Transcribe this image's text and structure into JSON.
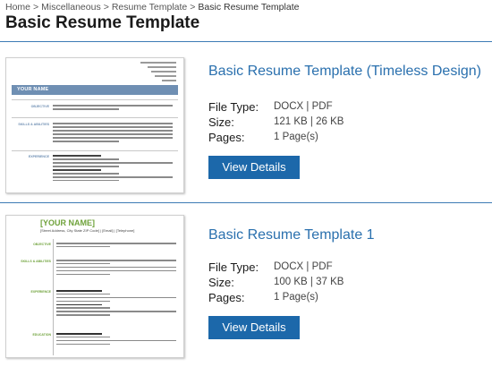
{
  "breadcrumb": {
    "items": [
      "Home",
      "Miscellaneous",
      "Resume Template"
    ],
    "separator": ">",
    "current": "Basic Resume Template"
  },
  "page": {
    "title": "Basic Resume Template"
  },
  "colors": {
    "accent": "#2a70ae",
    "button": "#1c68aa",
    "divider": "#3d7bb5",
    "thumb2_green": "#6fa23b",
    "thumb1_bar": "#6f8fb3"
  },
  "labels": {
    "file_type": "File Type:",
    "size": "Size:",
    "pages": "Pages:"
  },
  "templates": [
    {
      "title": "Basic Resume Template (Timeless Design)",
      "file_type": "DOCX | PDF",
      "size": "121 KB | 26 KB",
      "pages": "1 Page(s)",
      "button": "View Details",
      "thumbnail": {
        "name": "YOUR NAME",
        "sections": [
          "OBJECTIVE",
          "SKILLS & ABILITIES",
          "EXPERIENCE"
        ]
      }
    },
    {
      "title": "Basic Resume Template 1",
      "file_type": "DOCX | PDF",
      "size": "100 KB | 37 KB",
      "pages": "1 Page(s)",
      "button": "View Details",
      "thumbnail": {
        "name": "[YOUR NAME]",
        "address": "[Street Address, City State ZIP Code] | [Email] | [Telephone]",
        "sections": [
          "OBJECTIVE",
          "SKILLS & ABILITIES",
          "EXPERIENCE",
          "EDUCATION"
        ]
      }
    }
  ]
}
